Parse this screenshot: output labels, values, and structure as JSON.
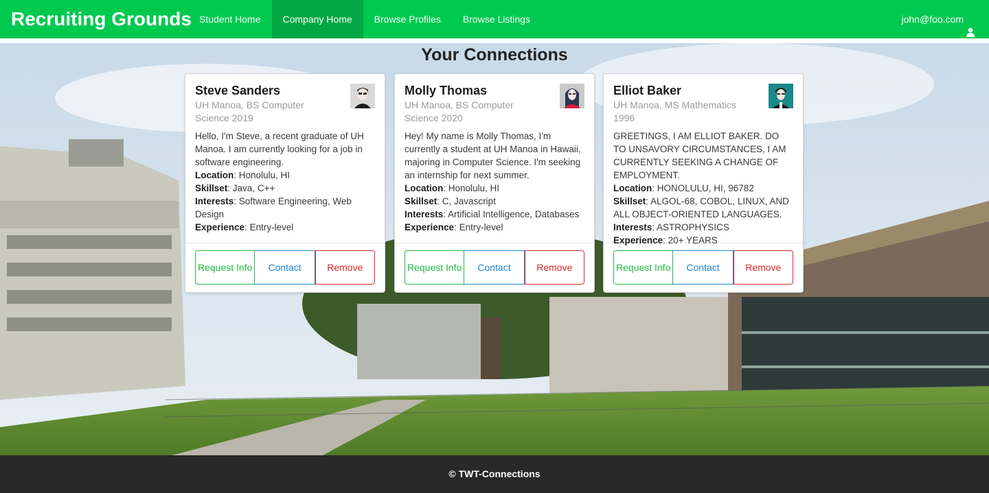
{
  "navbar": {
    "brand": "Recruiting Grounds",
    "items": [
      {
        "label": "Student Home",
        "active": false
      },
      {
        "label": "Company Home",
        "active": true
      },
      {
        "label": "Browse Profiles",
        "active": false
      },
      {
        "label": "Browse Listings",
        "active": false
      }
    ],
    "user_email": "john@foo.com",
    "user_icon": "user-icon"
  },
  "page": {
    "title": "Your Connections"
  },
  "cards": [
    {
      "name": "Steve Sanders",
      "meta": "UH Manoa, BS Computer Science 2019",
      "description": "Hello, I'm Steve, a recent graduate of UH Manoa. I am currently looking for a job in software engineering.",
      "location_label": "Location",
      "location": "Honolulu, HI",
      "skillset_label": "Skillset",
      "skillset": "Java, C++",
      "interests_label": "Interests",
      "interests": "Software Engineering, Web Design",
      "experience_label": "Experience",
      "experience": "Entry-level",
      "buttons": {
        "request": "Request Info",
        "contact": "Contact",
        "remove": "Remove"
      }
    },
    {
      "name": "Molly Thomas",
      "meta": "UH Manoa, BS Computer Science 2020",
      "description": "Hey! My name is Molly Thomas, I'm currently a student at UH Manoa in Hawaii, majoring in Computer Science. I'm seeking an internship for next summer.",
      "location_label": "Location",
      "location": "Honolulu, HI",
      "skillset_label": "Skillset",
      "skillset": "C, Javascript",
      "interests_label": "Interests",
      "interests": "Artificial Intelligence, Databases",
      "experience_label": "Experience",
      "experience": "Entry-level",
      "buttons": {
        "request": "Request Info",
        "contact": "Contact",
        "remove": "Remove"
      }
    },
    {
      "name": "Elliot Baker",
      "meta": "UH Manoa, MS Mathematics 1996",
      "description": "GREETINGS, I AM ELLIOT BAKER. DO TO UNSAVORY CIRCUMSTANCES, I AM CURRENTLY SEEKING A CHANGE OF EMPLOYMENT.",
      "location_label": "Location",
      "location": "HONOLULU, HI, 96782",
      "skillset_label": "Skillset",
      "skillset": "ALGOL-68, COBOL, LINUX, AND ALL OBJECT-ORIENTED LANGUAGES.",
      "interests_label": "Interests",
      "interests": "ASTROPHYSICS",
      "experience_label": "Experience",
      "experience": "20+ YEARS",
      "buttons": {
        "request": "Request Info",
        "contact": "Contact",
        "remove": "Remove"
      }
    }
  ],
  "footer": {
    "text": "© TWT-Connections"
  },
  "colors": {
    "navbar": "#00c950",
    "navbar_active": "#00a843",
    "request": "#21ba45",
    "contact": "#2185d0",
    "remove": "#db2828",
    "footer": "#282828"
  }
}
